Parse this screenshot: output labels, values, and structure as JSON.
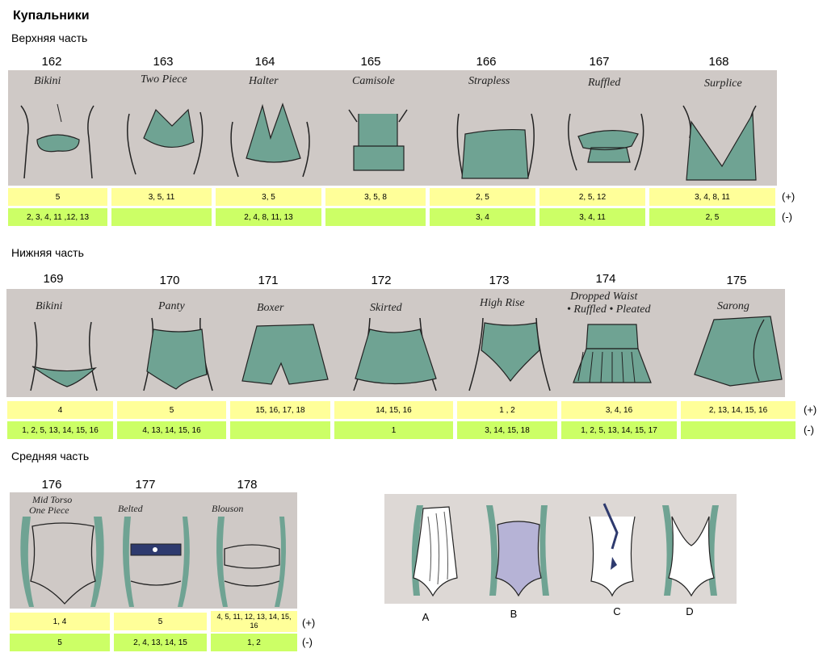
{
  "title": "Купальники",
  "sections": [
    {
      "heading": "Верхняя часть",
      "items": [
        {
          "num": "162",
          "label": "Bikini",
          "plus": "5",
          "minus": "2, 3, 4, 11 ,12, 13"
        },
        {
          "num": "163",
          "label": "Two Piece",
          "plus": "3, 5, 11",
          "minus": ""
        },
        {
          "num": "164",
          "label": "Halter",
          "plus": "3, 5",
          "minus": "2, 4, 8, 11, 13"
        },
        {
          "num": "165",
          "label": "Camisole",
          "plus": "3, 5, 8",
          "minus": ""
        },
        {
          "num": "166",
          "label": "Strapless",
          "plus": "2, 5",
          "minus": "3, 4"
        },
        {
          "num": "167",
          "label": "Ruffled",
          "plus": "2, 5, 12",
          "minus": "3, 4, 11"
        },
        {
          "num": "168",
          "label": "Surplice",
          "plus": "3, 4, 8, 11",
          "minus": "2, 5"
        }
      ]
    },
    {
      "heading": "Нижняя часть",
      "items": [
        {
          "num": "169",
          "label": "Bikini",
          "plus": "4",
          "minus": "1, 2, 5, 13, 14, 15, 16"
        },
        {
          "num": "170",
          "label": "Panty",
          "plus": "5",
          "minus": "4, 13, 14, 15, 16"
        },
        {
          "num": "171",
          "label": "Boxer",
          "plus": "15, 16, 17, 18",
          "minus": ""
        },
        {
          "num": "172",
          "label": "Skirted",
          "plus": "14, 15, 16",
          "minus": "1"
        },
        {
          "num": "173",
          "label": "High Rise",
          "plus": "1 , 2",
          "minus": "3, 14, 15, 18"
        },
        {
          "num": "174",
          "label": "Dropped Waist",
          "label2": "• Ruffled • Pleated",
          "plus": "3, 4, 16",
          "minus": "1, 2, 5, 13, 14, 15, 17"
        },
        {
          "num": "175",
          "label": "Sarong",
          "plus": "2, 13, 14, 15, 16",
          "minus": ""
        }
      ]
    },
    {
      "heading": "Средняя часть",
      "items": [
        {
          "num": "176",
          "label": "Mid Torso",
          "label2": "One Piece",
          "plus": "1, 4",
          "minus": "5"
        },
        {
          "num": "177",
          "label": "Belted",
          "plus": "5",
          "minus": "2, 4, 13, 14, 15"
        },
        {
          "num": "178",
          "label": "Blouson",
          "plus": "4, 5, 11, 12, 13, 14, 15, 16",
          "minus": "1, 2"
        }
      ]
    }
  ],
  "signs": {
    "plus": "(+)",
    "minus": "(-)"
  },
  "examples": [
    "A",
    "B",
    "C",
    "D"
  ],
  "colors": {
    "plus_fill": "#ffff99",
    "minus_fill": "#ccff66",
    "panel": "#cfc9c6",
    "garment": "#6fa393",
    "figure_line": "#222222"
  }
}
